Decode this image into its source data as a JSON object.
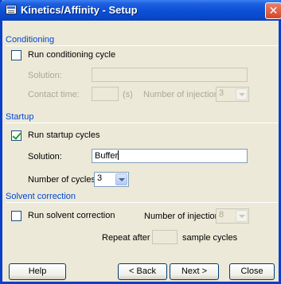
{
  "window": {
    "title": "Kinetics/Affinity - Setup",
    "close_glyph": "✕",
    "app_icon": "application-window-icon"
  },
  "conditioning": {
    "title": "Conditioning",
    "run_label": "Run conditioning cycle",
    "run_checked": false,
    "solution_label": "Solution:",
    "solution_value": "",
    "contact_time_label": "Contact time:",
    "contact_time_value": "",
    "contact_time_unit": "(s)",
    "injections_label": "Number of injections:",
    "injections_value": "3"
  },
  "startup": {
    "title": "Startup",
    "run_label": "Run startup cycles",
    "run_checked": true,
    "solution_label": "Solution:",
    "solution_value": "Buffer",
    "cycles_label": "Number of cycles:",
    "cycles_value": "3"
  },
  "solvent": {
    "title": "Solvent correction",
    "run_label": "Run solvent correction",
    "run_checked": false,
    "injections_label": "Number of injections:",
    "injections_value": "8",
    "repeat_label": "Repeat after",
    "repeat_value": "",
    "repeat_unit": "sample cycles"
  },
  "buttons": {
    "help": "Help",
    "back": "< Back",
    "next": "Next >",
    "close": "Close"
  }
}
